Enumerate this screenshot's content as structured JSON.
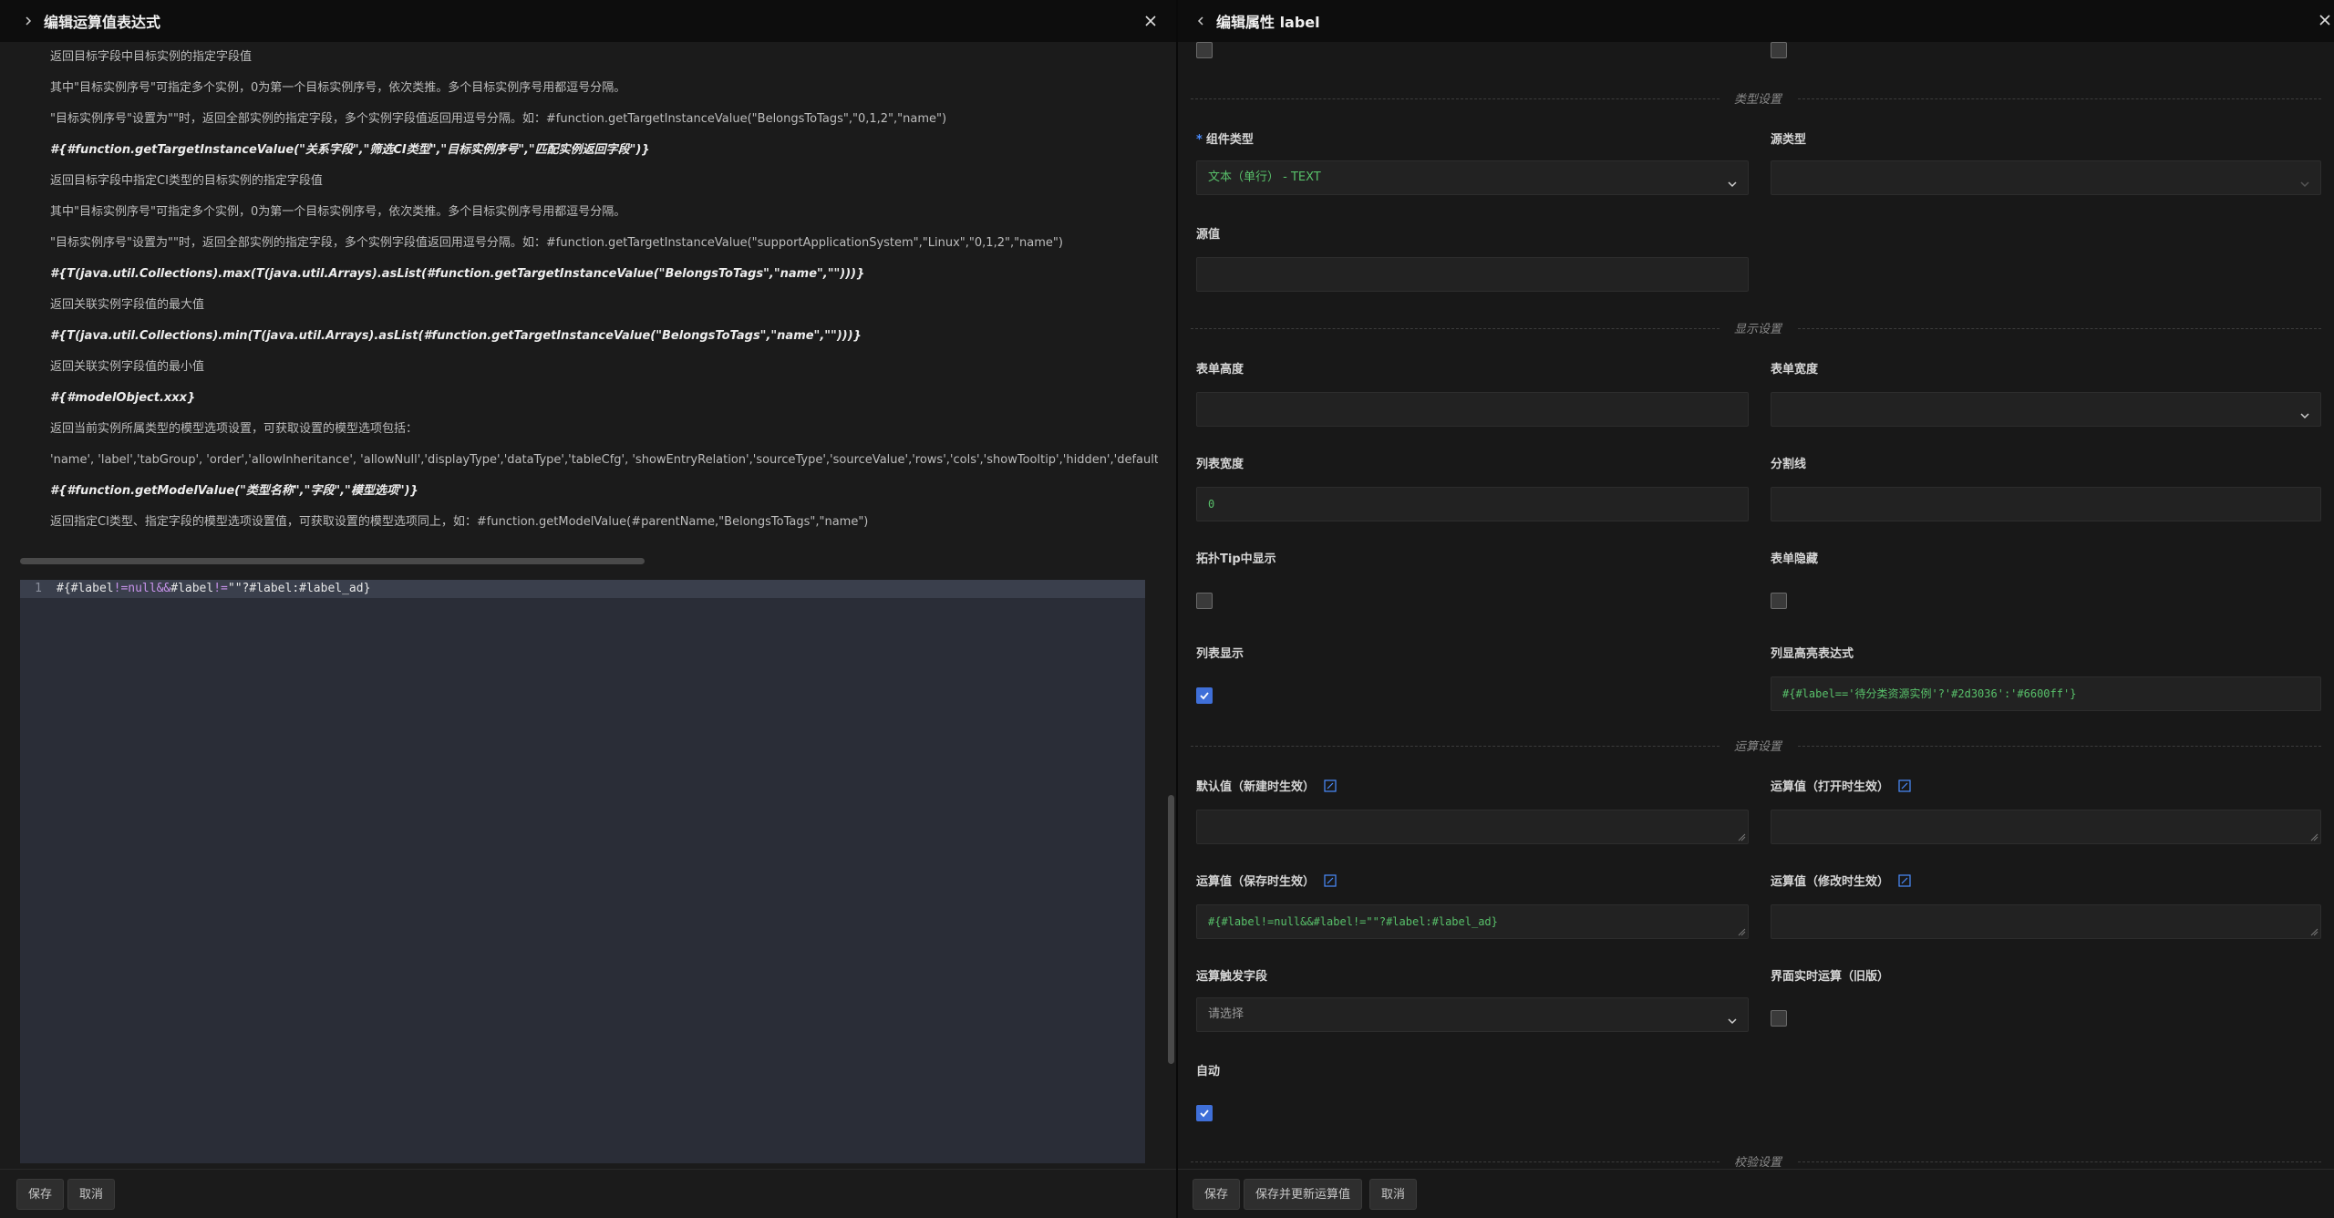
{
  "left_panel": {
    "title": "编辑运算值表达式",
    "help_lines": [
      {
        "text": "返回目标字段中目标实例的指定字段值",
        "bold": false
      },
      {
        "text": "其中\"目标实例序号\"可指定多个实例，0为第一个目标实例序号，依次类推。多个目标实例序号用都逗号分隔。",
        "bold": false
      },
      {
        "text": "\"目标实例序号\"设置为\"\"时，返回全部实例的指定字段，多个实例字段值返回用逗号分隔。如：#function.getTargetInstanceValue(\"BelongsToTags\",\"0,1,2\",\"name\")",
        "bold": false
      },
      {
        "text": "#{#function.getTargetInstanceValue(\"关系字段\",\"筛选CI类型\",\"目标实例序号\",\"匹配实例返回字段\")}",
        "bold": true
      },
      {
        "text": "返回目标字段中指定CI类型的目标实例的指定字段值",
        "bold": false
      },
      {
        "text": "其中\"目标实例序号\"可指定多个实例，0为第一个目标实例序号，依次类推。多个目标实例序号用都逗号分隔。",
        "bold": false
      },
      {
        "text": "\"目标实例序号\"设置为\"\"时，返回全部实例的指定字段，多个实例字段值返回用逗号分隔。如：#function.getTargetInstanceValue(\"supportApplicationSystem\",\"Linux\",\"0,1,2\",\"name\")",
        "bold": false
      },
      {
        "text": "#{T(java.util.Collections).max(T(java.util.Arrays).asList(#function.getTargetInstanceValue(\"BelongsToTags\",\"name\",\"\")))}",
        "bold": true
      },
      {
        "text": "返回关联实例字段值的最大值",
        "bold": false
      },
      {
        "text": "#{T(java.util.Collections).min(T(java.util.Arrays).asList(#function.getTargetInstanceValue(\"BelongsToTags\",\"name\",\"\")))}",
        "bold": true
      },
      {
        "text": "返回关联实例字段值的最小值",
        "bold": false
      },
      {
        "text": "#{#modelObject.xxx}",
        "bold": true
      },
      {
        "text": "返回当前实例所属类型的模型选项设置，可获取设置的模型选项包括：",
        "bold": false
      },
      {
        "text": "'name', 'label','tabGroup', 'order','allowInheritance', 'allowNull','displayType','dataType','tableCfg', 'showEntryRelation','sourceType','sourceValue','rows','cols','showTooltip','hidden','defaultValueString', 'o",
        "bold": false
      },
      {
        "text": "#{#function.getModelValue(\"类型名称\",\"字段\",\"模型选项\")}",
        "bold": true
      },
      {
        "text": "返回指定CI类型、指定字段的模型选项设置值，可获取设置的模型选项同上，如：#function.getModelValue(#parentName,\"BelongsToTags\",\"name\")",
        "bold": false
      }
    ],
    "editor": {
      "line_number": "1",
      "code_parts": [
        "#{#label",
        "!=",
        "null",
        "&&",
        "#label",
        "!=",
        "\"\"",
        "?#label:#label_ad}"
      ]
    },
    "footer": {
      "save": "保存",
      "cancel": "取消"
    }
  },
  "right_panel": {
    "title": "编辑属性 label",
    "sections": {
      "type": "类型设置",
      "display": "显示设置",
      "compute": "运算设置",
      "verify": "校验设置"
    },
    "fields": {
      "component_type": {
        "label": "组件类型",
        "value": "文本（单行） - TEXT"
      },
      "source_type": {
        "label": "源类型",
        "value": ""
      },
      "source_value": {
        "label": "源值",
        "value": ""
      },
      "form_height": {
        "label": "表单高度",
        "value": ""
      },
      "form_width": {
        "label": "表单宽度",
        "value": ""
      },
      "list_width": {
        "label": "列表宽度",
        "value": "0"
      },
      "divider": {
        "label": "分割线",
        "value": ""
      },
      "topo_tip": {
        "label": "拓扑Tip中显示",
        "checked": false
      },
      "form_hidden": {
        "label": "表单隐藏",
        "checked": false
      },
      "list_show": {
        "label": "列表显示",
        "checked": true
      },
      "col_highlight": {
        "label": "列显高亮表达式",
        "value": "#{#label=='待分类资源实例'?'#2d3036':'#6600ff'}"
      },
      "default_new": {
        "label": "默认值（新建时生效）",
        "value": ""
      },
      "compute_open": {
        "label": "运算值（打开时生效）",
        "value": ""
      },
      "compute_save": {
        "label": "运算值（保存时生效）",
        "value": "#{#label!=null&&#label!=\"\"?#label:#label_ad}"
      },
      "compute_modify": {
        "label": "运算值（修改时生效）",
        "value": ""
      },
      "trigger_field": {
        "label": "运算触发字段",
        "placeholder": "请选择"
      },
      "realtime_compute": {
        "label": "界面实时运算（旧版）",
        "checked": false
      },
      "auto": {
        "label": "自动",
        "checked": true
      }
    },
    "footer": {
      "save": "保存",
      "save_update": "保存并更新运算值",
      "cancel": "取消"
    }
  },
  "colors": {
    "accent": "#3f6fd8",
    "code_green": "#58c06a",
    "editor_bg": "#2a2d37"
  }
}
